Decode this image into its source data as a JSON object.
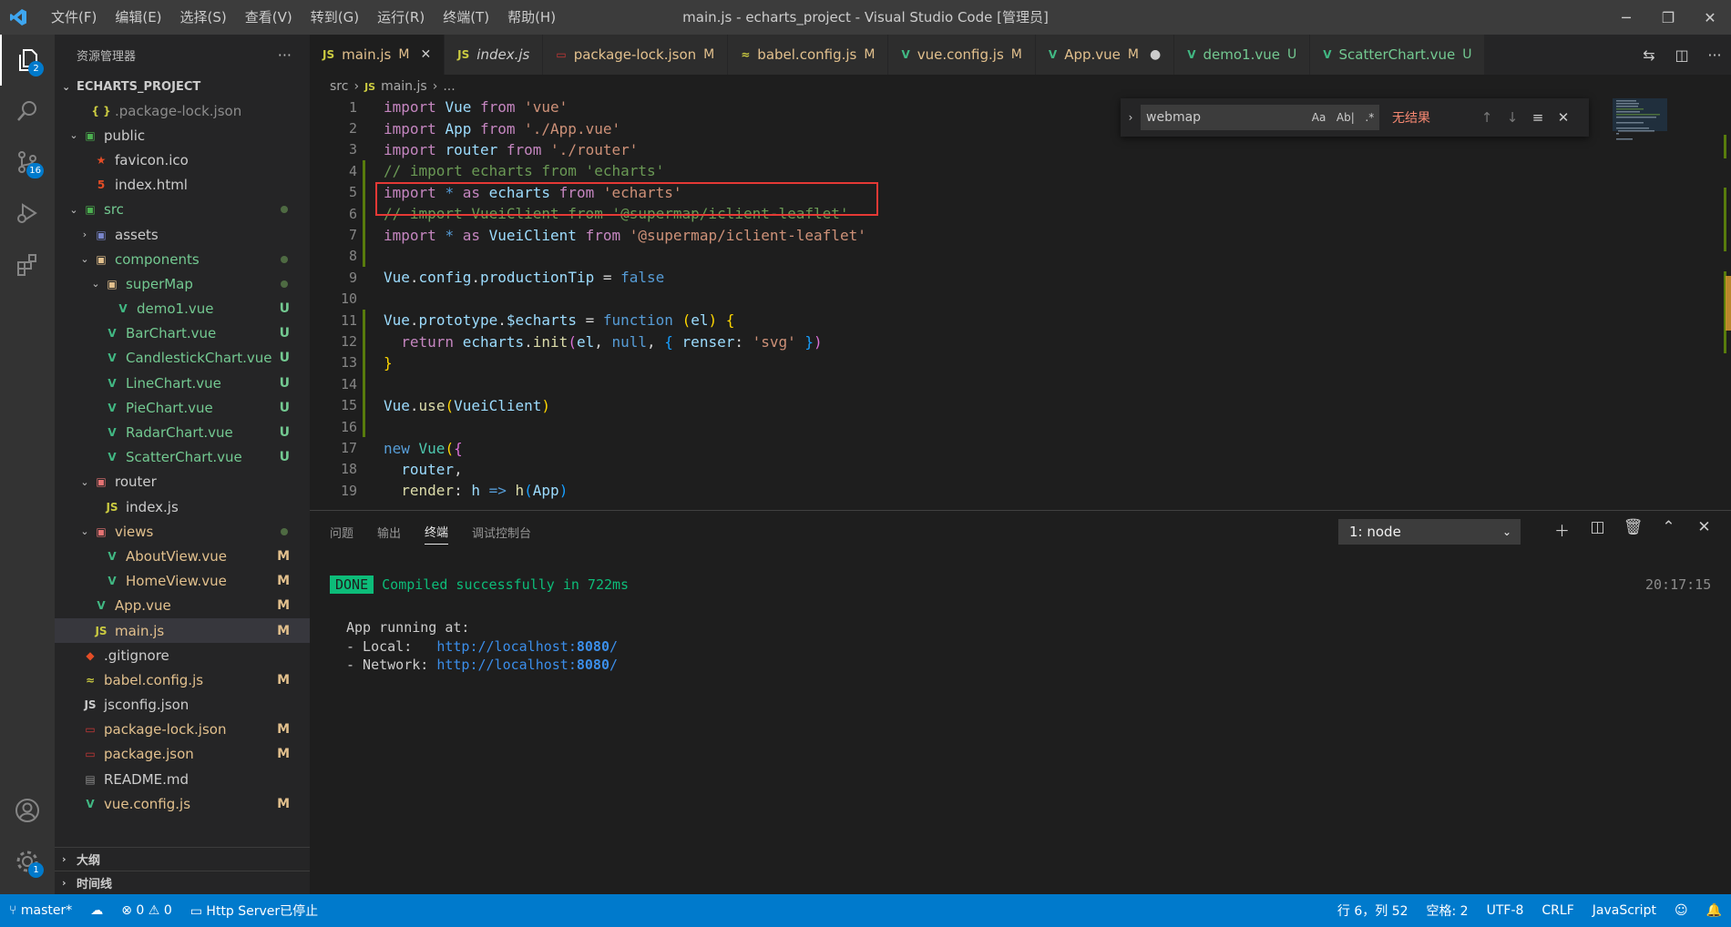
{
  "titlebar": {
    "menu": [
      "文件(F)",
      "编辑(E)",
      "选择(S)",
      "查看(V)",
      "转到(G)",
      "运行(R)",
      "终端(T)",
      "帮助(H)"
    ],
    "title": "main.js - echarts_project - Visual Studio Code [管理员]",
    "controls": [
      "─",
      "❐",
      "✕"
    ]
  },
  "activity": {
    "explorer_badge": "2",
    "scm_badge": "16",
    "settings_badge": "1"
  },
  "sidebar": {
    "header": "资源管理器",
    "project": "ECHARTS_PROJECT",
    "tree": [
      {
        "label": ".package-lock.json",
        "icon": "{ }",
        "twisty": "",
        "status": "",
        "dot": false,
        "indent": 1,
        "color": "c-dim",
        "icon_color": "#cbcb41"
      },
      {
        "label": "public",
        "icon": "▣",
        "twisty": "⌄",
        "status": "",
        "dot": false,
        "indent": 0,
        "color": "c-plain",
        "icon_color": "#4caf50"
      },
      {
        "label": "favicon.ico",
        "icon": "★",
        "twisty": "",
        "status": "",
        "dot": false,
        "indent": 1,
        "color": "c-plain",
        "icon_color": "#e44d26"
      },
      {
        "label": "index.html",
        "icon": "5",
        "twisty": "",
        "status": "",
        "dot": false,
        "indent": 1,
        "color": "c-plain",
        "icon_color": "#e44d26"
      },
      {
        "label": "src",
        "icon": "▣",
        "twisty": "⌄",
        "status": "",
        "dot": true,
        "indent": 0,
        "color": "c-green",
        "icon_color": "#4caf50"
      },
      {
        "label": "assets",
        "icon": "▣",
        "twisty": "›",
        "status": "",
        "dot": false,
        "indent": 1,
        "color": "c-plain",
        "icon_color": "#7986cb"
      },
      {
        "label": "components",
        "icon": "▣",
        "twisty": "⌄",
        "status": "",
        "dot": true,
        "indent": 1,
        "color": "c-green",
        "icon_color": "#e2c08d"
      },
      {
        "label": "superMap",
        "icon": "▣",
        "twisty": "⌄",
        "status": "",
        "dot": true,
        "indent": 2,
        "color": "c-green",
        "icon_color": "#e2c08d"
      },
      {
        "label": "demo1.vue",
        "icon": "V",
        "twisty": "",
        "status": "U",
        "dot": false,
        "indent": 3,
        "color": "c-green",
        "icon_color": "#41b883"
      },
      {
        "label": "BarChart.vue",
        "icon": "V",
        "twisty": "",
        "status": "U",
        "dot": false,
        "indent": 2,
        "color": "c-green",
        "icon_color": "#41b883"
      },
      {
        "label": "CandlestickChart.vue",
        "icon": "V",
        "twisty": "",
        "status": "U",
        "dot": false,
        "indent": 2,
        "color": "c-green",
        "icon_color": "#41b883"
      },
      {
        "label": "LineChart.vue",
        "icon": "V",
        "twisty": "",
        "status": "U",
        "dot": false,
        "indent": 2,
        "color": "c-green",
        "icon_color": "#41b883"
      },
      {
        "label": "PieChart.vue",
        "icon": "V",
        "twisty": "",
        "status": "U",
        "dot": false,
        "indent": 2,
        "color": "c-green",
        "icon_color": "#41b883"
      },
      {
        "label": "RadarChart.vue",
        "icon": "V",
        "twisty": "",
        "status": "U",
        "dot": false,
        "indent": 2,
        "color": "c-green",
        "icon_color": "#41b883"
      },
      {
        "label": "ScatterChart.vue",
        "icon": "V",
        "twisty": "",
        "status": "U",
        "dot": false,
        "indent": 2,
        "color": "c-green",
        "icon_color": "#41b883"
      },
      {
        "label": "router",
        "icon": "▣",
        "twisty": "⌄",
        "status": "",
        "dot": false,
        "indent": 1,
        "color": "c-plain",
        "icon_color": "#e57373"
      },
      {
        "label": "index.js",
        "icon": "JS",
        "twisty": "",
        "status": "",
        "dot": false,
        "indent": 2,
        "color": "c-plain",
        "icon_color": "#cbcb41"
      },
      {
        "label": "views",
        "icon": "▣",
        "twisty": "⌄",
        "status": "",
        "dot": true,
        "indent": 1,
        "color": "c-yellow",
        "icon_color": "#e57373"
      },
      {
        "label": "AboutView.vue",
        "icon": "V",
        "twisty": "",
        "status": "M",
        "dot": false,
        "indent": 2,
        "color": "c-yellow",
        "icon_color": "#41b883"
      },
      {
        "label": "HomeView.vue",
        "icon": "V",
        "twisty": "",
        "status": "M",
        "dot": false,
        "indent": 2,
        "color": "c-yellow",
        "icon_color": "#41b883"
      },
      {
        "label": "App.vue",
        "icon": "V",
        "twisty": "",
        "status": "M",
        "dot": false,
        "indent": 1,
        "color": "c-yellow",
        "icon_color": "#41b883"
      },
      {
        "label": "main.js",
        "icon": "JS",
        "twisty": "",
        "status": "M",
        "dot": false,
        "indent": 1,
        "color": "c-yellow",
        "icon_color": "#cbcb41",
        "selected": true
      },
      {
        "label": ".gitignore",
        "icon": "◆",
        "twisty": "",
        "status": "",
        "dot": false,
        "indent": 0,
        "color": "c-plain",
        "icon_color": "#e44d26"
      },
      {
        "label": "babel.config.js",
        "icon": "≈",
        "twisty": "",
        "status": "M",
        "dot": false,
        "indent": 0,
        "color": "c-yellow",
        "icon_color": "#cbcb41"
      },
      {
        "label": "jsconfig.json",
        "icon": "JS",
        "twisty": "",
        "status": "",
        "dot": false,
        "indent": 0,
        "color": "c-plain",
        "icon_color": "#cccccc"
      },
      {
        "label": "package-lock.json",
        "icon": "▭",
        "twisty": "",
        "status": "M",
        "dot": false,
        "indent": 0,
        "color": "c-yellow",
        "icon_color": "#cb3837"
      },
      {
        "label": "package.json",
        "icon": "▭",
        "twisty": "",
        "status": "M",
        "dot": false,
        "indent": 0,
        "color": "c-yellow",
        "icon_color": "#cb3837"
      },
      {
        "label": "README.md",
        "icon": "▤",
        "twisty": "",
        "status": "",
        "dot": false,
        "indent": 0,
        "color": "c-plain",
        "icon_color": "#8c8c8c"
      },
      {
        "label": "vue.config.js",
        "icon": "V",
        "twisty": "",
        "status": "M",
        "dot": false,
        "indent": 0,
        "color": "c-yellow",
        "icon_color": "#41b883"
      }
    ],
    "outline": "大纲",
    "timeline": "时间线"
  },
  "tabs": [
    {
      "label": "main.js",
      "icon": "JS",
      "icon_color": "#cbcb41",
      "status": "M",
      "active": true,
      "italic": false,
      "close": "✕",
      "color": "#e2c08d"
    },
    {
      "label": "index.js",
      "icon": "JS",
      "icon_color": "#cbcb41",
      "status": "",
      "active": false,
      "italic": true,
      "close": "",
      "color": "#cccccc"
    },
    {
      "label": "package-lock.json",
      "icon": "▭",
      "icon_color": "#cb3837",
      "status": "M",
      "active": false,
      "italic": false,
      "close": "",
      "color": "#e2c08d"
    },
    {
      "label": "babel.config.js",
      "icon": "≈",
      "icon_color": "#cbcb41",
      "status": "M",
      "active": false,
      "italic": false,
      "close": "",
      "color": "#e2c08d"
    },
    {
      "label": "vue.config.js",
      "icon": "V",
      "icon_color": "#41b883",
      "status": "M",
      "active": false,
      "italic": false,
      "close": "",
      "color": "#e2c08d"
    },
    {
      "label": "App.vue",
      "icon": "V",
      "icon_color": "#41b883",
      "status": "M",
      "active": false,
      "italic": false,
      "close": "●",
      "color": "#e2c08d"
    },
    {
      "label": "demo1.vue",
      "icon": "V",
      "icon_color": "#41b883",
      "status": "U",
      "active": false,
      "italic": false,
      "close": "",
      "color": "#73c991"
    },
    {
      "label": "ScatterChart.vue",
      "icon": "V",
      "icon_color": "#41b883",
      "status": "U",
      "active": false,
      "italic": false,
      "close": "",
      "color": "#73c991"
    }
  ],
  "breadcrumb": [
    "src",
    "›",
    "JS",
    "main.js",
    "›",
    "..."
  ],
  "find": {
    "value": "webmap",
    "options": [
      "Aa",
      "Ab|",
      ".*"
    ],
    "result": "无结果"
  },
  "code": [
    {
      "n": "1",
      "mod": false,
      "tokens": [
        [
          "import ",
          "#c586c0"
        ],
        [
          "Vue ",
          "#9cdcfe"
        ],
        [
          "from ",
          "#c586c0"
        ],
        [
          "'vue'",
          "#ce9178"
        ]
      ]
    },
    {
      "n": "2",
      "mod": false,
      "tokens": [
        [
          "import ",
          "#c586c0"
        ],
        [
          "App ",
          "#9cdcfe"
        ],
        [
          "from ",
          "#c586c0"
        ],
        [
          "'./App.vue'",
          "#ce9178"
        ]
      ]
    },
    {
      "n": "3",
      "mod": false,
      "tokens": [
        [
          "import ",
          "#c586c0"
        ],
        [
          "router ",
          "#9cdcfe"
        ],
        [
          "from ",
          "#c586c0"
        ],
        [
          "'./router'",
          "#ce9178"
        ]
      ]
    },
    {
      "n": "4",
      "mod": true,
      "tokens": [
        [
          "// import echarts from 'echarts'",
          "#6a9955"
        ]
      ]
    },
    {
      "n": "5",
      "mod": true,
      "tokens": [
        [
          "import ",
          "#c586c0"
        ],
        [
          "* ",
          "#569cd6"
        ],
        [
          "as ",
          "#c586c0"
        ],
        [
          "echarts ",
          "#9cdcfe"
        ],
        [
          "from ",
          "#c586c0"
        ],
        [
          "'echarts'",
          "#ce9178"
        ]
      ]
    },
    {
      "n": "6",
      "mod": true,
      "tokens": [
        [
          "// import VueiClient from '@supermap/iclient-leaflet'",
          "#6a9955"
        ]
      ]
    },
    {
      "n": "7",
      "mod": true,
      "tokens": [
        [
          "import ",
          "#c586c0"
        ],
        [
          "* ",
          "#569cd6"
        ],
        [
          "as ",
          "#c586c0"
        ],
        [
          "VueiClient ",
          "#9cdcfe"
        ],
        [
          "from ",
          "#c586c0"
        ],
        [
          "'@supermap/iclient-leaflet'",
          "#ce9178"
        ]
      ]
    },
    {
      "n": "8",
      "mod": true,
      "tokens": []
    },
    {
      "n": "9",
      "mod": false,
      "tokens": [
        [
          "Vue",
          "#9cdcfe"
        ],
        [
          ".",
          "#d4d4d4"
        ],
        [
          "config",
          "#9cdcfe"
        ],
        [
          ".",
          "#d4d4d4"
        ],
        [
          "productionTip",
          "#9cdcfe"
        ],
        [
          " = ",
          "#d4d4d4"
        ],
        [
          "false",
          "#569cd6"
        ]
      ]
    },
    {
      "n": "10",
      "mod": false,
      "tokens": []
    },
    {
      "n": "11",
      "mod": true,
      "tokens": [
        [
          "Vue",
          "#9cdcfe"
        ],
        [
          ".",
          "#d4d4d4"
        ],
        [
          "prototype",
          "#9cdcfe"
        ],
        [
          ".",
          "#d4d4d4"
        ],
        [
          "$echarts",
          "#9cdcfe"
        ],
        [
          " = ",
          "#d4d4d4"
        ],
        [
          "function ",
          "#569cd6"
        ],
        [
          "(",
          "#ffd700"
        ],
        [
          "el",
          "#9cdcfe"
        ],
        [
          ") ",
          "#ffd700"
        ],
        [
          "{",
          "#ffd700"
        ]
      ]
    },
    {
      "n": "12",
      "mod": true,
      "tokens": [
        [
          "  return ",
          "#c586c0"
        ],
        [
          "echarts",
          "#9cdcfe"
        ],
        [
          ".",
          "#d4d4d4"
        ],
        [
          "init",
          "#dcdcaa"
        ],
        [
          "(",
          "#da70d6"
        ],
        [
          "el",
          "#9cdcfe"
        ],
        [
          ", ",
          "#d4d4d4"
        ],
        [
          "null",
          "#569cd6"
        ],
        [
          ", ",
          "#d4d4d4"
        ],
        [
          "{ ",
          "#179fff"
        ],
        [
          "renser",
          "#9cdcfe"
        ],
        [
          ": ",
          "#d4d4d4"
        ],
        [
          "'svg'",
          "#ce9178"
        ],
        [
          " }",
          "#179fff"
        ],
        [
          ")",
          "#da70d6"
        ]
      ]
    },
    {
      "n": "13",
      "mod": true,
      "tokens": [
        [
          "}",
          "#ffd700"
        ]
      ]
    },
    {
      "n": "14",
      "mod": true,
      "tokens": []
    },
    {
      "n": "15",
      "mod": true,
      "tokens": [
        [
          "Vue",
          "#9cdcfe"
        ],
        [
          ".",
          "#d4d4d4"
        ],
        [
          "use",
          "#dcdcaa"
        ],
        [
          "(",
          "#ffd700"
        ],
        [
          "VueiClient",
          "#9cdcfe"
        ],
        [
          ")",
          "#ffd700"
        ]
      ]
    },
    {
      "n": "16",
      "mod": true,
      "tokens": []
    },
    {
      "n": "17",
      "mod": false,
      "tokens": [
        [
          "new ",
          "#569cd6"
        ],
        [
          "Vue",
          "#4ec9b0"
        ],
        [
          "(",
          "#ffd700"
        ],
        [
          "{",
          "#da70d6"
        ]
      ]
    },
    {
      "n": "18",
      "mod": false,
      "tokens": [
        [
          "  router",
          "#9cdcfe"
        ],
        [
          ",",
          "#d4d4d4"
        ]
      ]
    },
    {
      "n": "19",
      "mod": false,
      "tokens": [
        [
          "  render",
          "#dcdcaa"
        ],
        [
          ": ",
          "#d4d4d4"
        ],
        [
          "h ",
          "#9cdcfe"
        ],
        [
          "=> ",
          "#569cd6"
        ],
        [
          "h",
          "#dcdcaa"
        ],
        [
          "(",
          "#179fff"
        ],
        [
          "App",
          "#9cdcfe"
        ],
        [
          ")",
          "#179fff"
        ]
      ]
    }
  ],
  "panel": {
    "tabs": [
      "问题",
      "输出",
      "终端",
      "调试控制台"
    ],
    "active_tab": "终端",
    "terminal_select": "1: node",
    "done": "DONE",
    "compiled": "Compiled successfully in 722ms",
    "time": "20:17:15",
    "running": "App running at:",
    "local_label": "- Local:   ",
    "local_url": "http://localhost:",
    "local_port": "8080",
    "local_slash": "/",
    "network_label": "- Network: ",
    "network_url": "http://localhost:",
    "network_port": "8080",
    "network_slash": "/"
  },
  "statusbar": {
    "branch": "master*",
    "errors": "0",
    "warnings": "0",
    "server": "Http Server已停止",
    "position": "行 6，列 52",
    "spaces": "空格: 2",
    "encoding": "UTF-8",
    "eol": "CRLF",
    "language": "JavaScript"
  }
}
